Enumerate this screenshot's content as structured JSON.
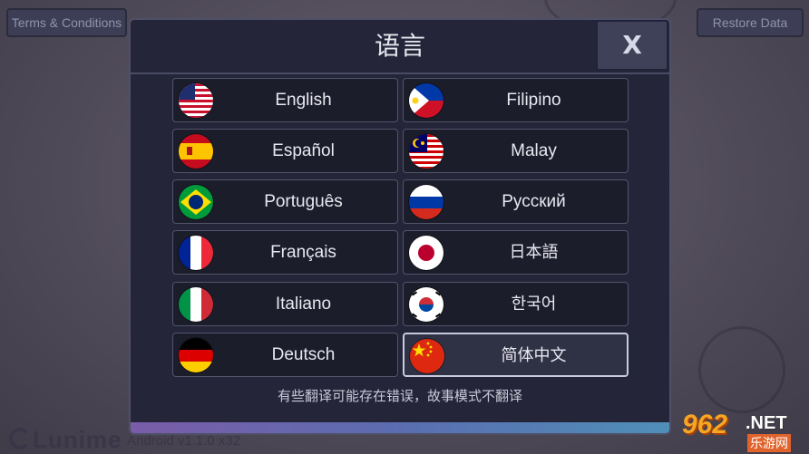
{
  "top_bar": {
    "terms_label": "Terms & Conditions",
    "restore_label": "Restore Data"
  },
  "footer": {
    "brand": "Lunime",
    "version": "Android v1.1.0 x32"
  },
  "watermark": {
    "num": "962",
    "net": ".NET",
    "site": "乐游网"
  },
  "dialog": {
    "title": "语言",
    "close_label": "X",
    "note": "有些翻译可能存在错误，故事模式不翻译",
    "languages": [
      {
        "label": "English",
        "flag": "us-flag-icon"
      },
      {
        "label": "Filipino",
        "flag": "philippines-flag-icon"
      },
      {
        "label": "Español",
        "flag": "spain-flag-icon"
      },
      {
        "label": "Malay",
        "flag": "malaysia-flag-icon"
      },
      {
        "label": "Português",
        "flag": "brazil-flag-icon"
      },
      {
        "label": "Русский",
        "flag": "russia-flag-icon"
      },
      {
        "label": "Français",
        "flag": "france-flag-icon"
      },
      {
        "label": "日本語",
        "flag": "japan-flag-icon"
      },
      {
        "label": "Italiano",
        "flag": "italy-flag-icon"
      },
      {
        "label": "한국어",
        "flag": "korea-flag-icon"
      },
      {
        "label": "Deutsch",
        "flag": "germany-flag-icon"
      },
      {
        "label": "简体中文",
        "flag": "china-flag-icon"
      }
    ],
    "selected_language": "简体中文"
  },
  "colors": {
    "dialog_bg": "#242539",
    "button_bg": "#1c1d2b",
    "selected_border": "#c8cadd"
  }
}
